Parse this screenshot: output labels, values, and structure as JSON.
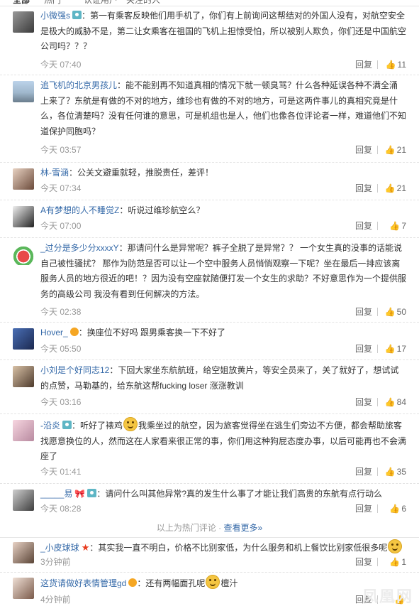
{
  "topbar": {
    "t1": "全部",
    "t2": "热门",
    "t3": "认证用户",
    "t4": "关注的人"
  },
  "comments": [
    {
      "user": "小微强s",
      "badge": "cam",
      "text": "：第一有乘客反映他们用手机了，你们有上前询问这帮结对的外国人没有，对航空安全是极大的威胁不是，第二让女乘客在祖国的飞机上担惊受怕，所以被别人欺负，你们还是中国航空公司吗？？？",
      "time": "今天 07:40",
      "reply": "回复",
      "likes": "11"
    },
    {
      "user": "追飞机的北京男孩儿",
      "badge": "",
      "text": "：能不能别再不知道真相的情况下就一顿臭骂？什么各种延误各种不满全涌上来了？东航是有做的不对的地方，维珍也有做的不对的地方，可是这两件事儿的真相究竟是什么，各位清楚吗？没有任何谁的意思，可是机组也是人，他们也像各位评论者一样，难道他们不知道保护同胞吗？",
      "time": "今天 03:57",
      "reply": "回复",
      "likes": "21"
    },
    {
      "user": "林-雪涵",
      "badge": "",
      "text": "：公关文避重就轻，推脱责任，差评！",
      "time": "今天 07:34",
      "reply": "回复",
      "likes": "21"
    },
    {
      "user": "A有梦想的人不睡觉Z",
      "badge": "",
      "text": "：听说过维珍航空么？",
      "time": "今天 07:00",
      "reply": "回复",
      "likes": "7"
    },
    {
      "user": "_过分是多少分xxxxY",
      "badge": "",
      "text": "：那请问什么是异常呢？裤子全脱了是异常？？ 一个女生真的没事的话能说自己被性骚扰？ 那作为防范是否可以让一个空中服务人员悄悄观察一下呢？坐在最后一排应该离服务人员的地方很近的吧！？因为没有空座就随便打发一个女生的求助？不好意思作为一个提供服务的高级公司 我没有看到任何解决的方法。",
      "time": "今天 02:38",
      "reply": "回复",
      "likes": "50"
    },
    {
      "user": "Hover_",
      "badge": "vip",
      "text": "：换座位不好吗 跟男乘客换一下不好了",
      "time": "今天 05:50",
      "reply": "回复",
      "likes": "17"
    },
    {
      "user": "小刘是个好同志12",
      "badge": "",
      "text": "：下回大家坐东航航班，给空姐放黄片，等安全员来了，关了就好了，想试试的点赞，马勒基的，给东航这帮fucking loser 涨涨教训",
      "time": "今天 03:16",
      "reply": "回复",
      "likes": "84"
    },
    {
      "user": "-沿炎",
      "badge": "cam",
      "text_a": "：听好了裱鸡",
      "text_b": "我乘坐过的航空，因为旅客觉得坐在逃生们旁边不方便，都会帮助旅客找愿意换位的人，然而这在人家看来很正常的事，你们用这种狗屁态度办事，以后可能再也不会满座了",
      "time": "今天 01:41",
      "reply": "回复",
      "likes": "35"
    },
    {
      "user": "_____易",
      "badge": "bow",
      "text": "：请问什么叫其他异常?真的发生什么事了才能让我们高贵的东航有点行动么",
      "time": "今天 08:28",
      "reply": "回复",
      "likes": "6"
    }
  ],
  "hotline": {
    "label": "以上为热门评论 ·",
    "more": "查看更多»"
  },
  "recent": [
    {
      "user": "_小皮球球",
      "badge": "star",
      "text": "：其实我一直不明白，价格不比别家低，为什么服务和机上餐饮比别家低很多呢",
      "time": "3分钟前",
      "reply": "回复",
      "likes": "1"
    },
    {
      "user": "这货请做好表情管理gd",
      "badge": "vip",
      "text_a": "：还有两幅面孔呢",
      "text_b": "檀汁",
      "time": "4分钟前",
      "reply": "回复",
      "likes": ""
    }
  ],
  "watermark": "凤凰网"
}
